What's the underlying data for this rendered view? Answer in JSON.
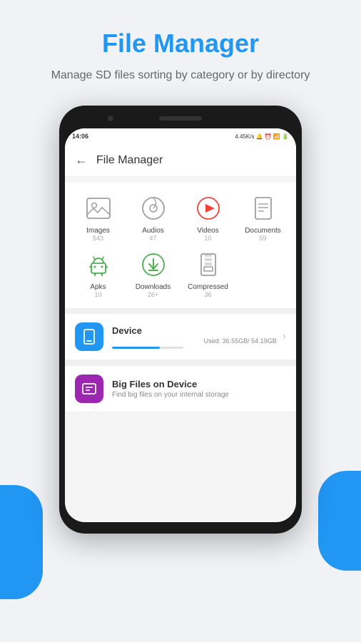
{
  "header": {
    "title": "File Manager",
    "subtitle": "Manage SD files sorting by category or by directory"
  },
  "status_bar": {
    "time": "14:06",
    "speed": "4.45K/s",
    "battery": "100"
  },
  "appbar": {
    "title": "File Manager",
    "back_label": "←"
  },
  "categories_row1": [
    {
      "id": "images",
      "label": "Images",
      "count": "543",
      "color": "#9E9E9E"
    },
    {
      "id": "audios",
      "label": "Audios",
      "count": "47",
      "color": "#9E9E9E"
    },
    {
      "id": "videos",
      "label": "Videos",
      "count": "10",
      "color": "#F44336"
    },
    {
      "id": "documents",
      "label": "Documents",
      "count": "59",
      "color": "#9E9E9E"
    }
  ],
  "categories_row2": [
    {
      "id": "apks",
      "label": "Apks",
      "count": "10",
      "color": "#4CAF50"
    },
    {
      "id": "downloads",
      "label": "Downloads",
      "count": "26+",
      "color": "#4CAF50"
    },
    {
      "id": "compressed",
      "label": "Compressed",
      "count": "36",
      "color": "#9E9E9E"
    }
  ],
  "device_storage": {
    "title": "Device",
    "used_label": "Used: 36.55GB/ 54.19GB",
    "progress": 67
  },
  "big_files": {
    "title": "Big Files on Device",
    "subtitle": "Find big files on your internal storage"
  }
}
